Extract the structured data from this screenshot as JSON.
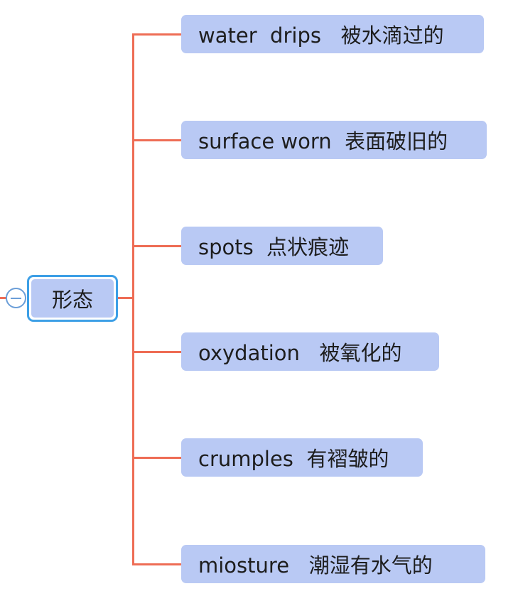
{
  "mindmap": {
    "root": {
      "label": "形态"
    },
    "children": [
      {
        "label": "water  drips   被水滴过的"
      },
      {
        "label": "surface worn  表面破旧的"
      },
      {
        "label": "spots  点状痕迹"
      },
      {
        "label": "oxydation   被氧化的"
      },
      {
        "label": "crumples  有褶皱的"
      },
      {
        "label": "miosture   潮湿有水气的"
      }
    ]
  },
  "colors": {
    "connector": "#ee6d55",
    "node_fill": "#b9c9f4",
    "root_border": "#3d9fe6",
    "toggle": "#6b9ed8"
  },
  "icons": {
    "collapse_toggle": "minus-circle-icon"
  }
}
